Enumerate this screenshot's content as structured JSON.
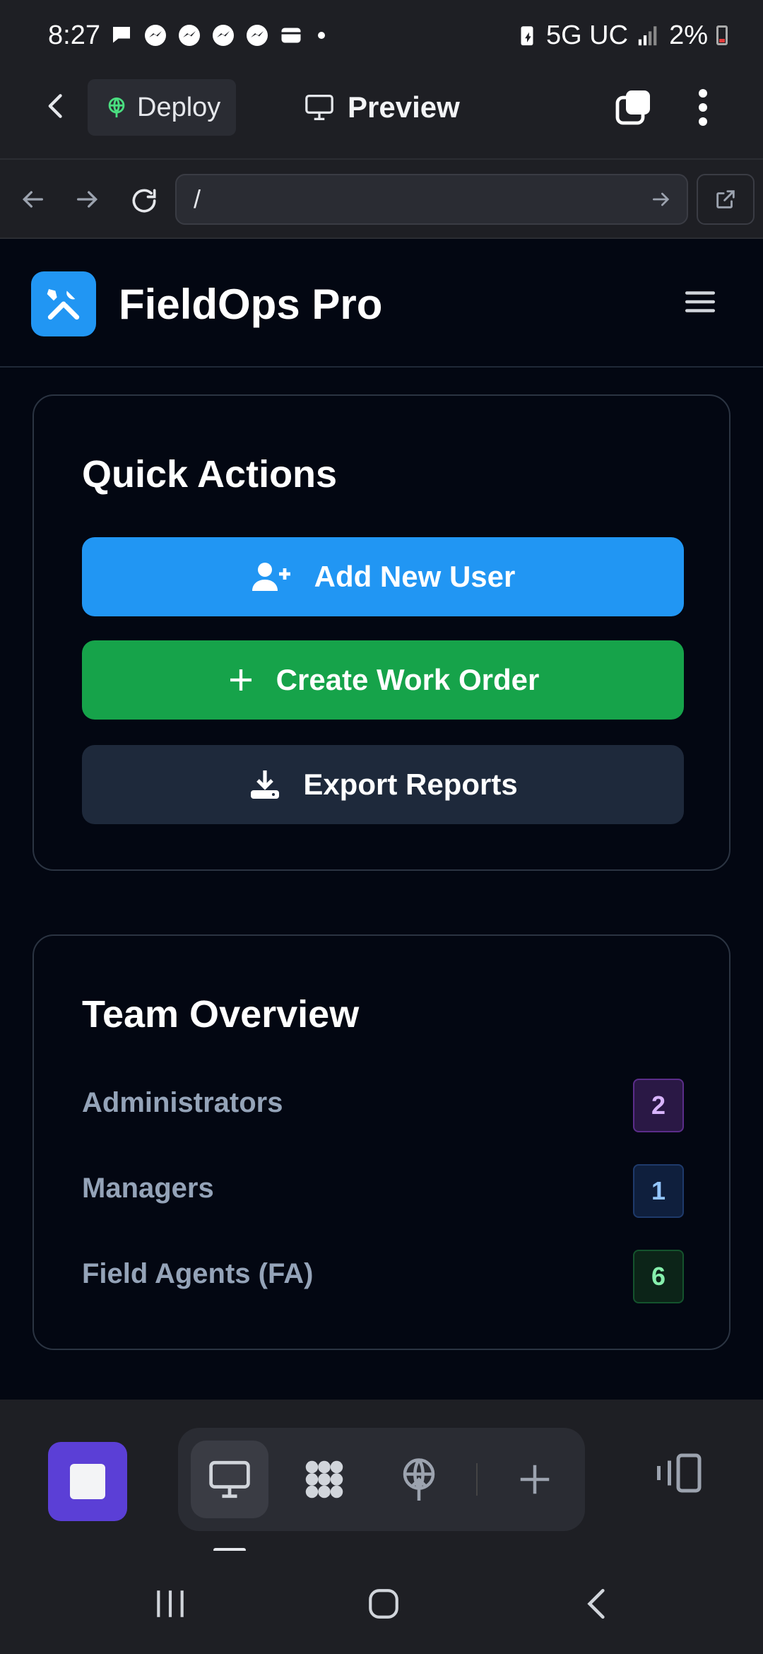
{
  "status_bar": {
    "time": "8:27",
    "network": "5G UC",
    "battery": "2%"
  },
  "app_header": {
    "deploy_label": "Deploy",
    "preview_label": "Preview"
  },
  "url_bar": {
    "value": "/"
  },
  "site": {
    "brand": "FieldOps Pro"
  },
  "quick_actions": {
    "title": "Quick Actions",
    "buttons": [
      {
        "label": "Add New User",
        "icon": "user-plus-icon",
        "color": "#2196f3"
      },
      {
        "label": "Create Work Order",
        "icon": "plus-icon",
        "color": "#16a34a"
      },
      {
        "label": "Export Reports",
        "icon": "download-icon",
        "color": "#1e293b"
      }
    ]
  },
  "team_overview": {
    "title": "Team Overview",
    "rows": [
      {
        "label": "Administrators",
        "count": "2",
        "color": "#d8b4fe",
        "bg": "#2a1845",
        "border": "#5b2d8a"
      },
      {
        "label": "Managers",
        "count": "1",
        "color": "#93c5fd",
        "bg": "#0f1f3d",
        "border": "#1e3a6b"
      },
      {
        "label": "Field Agents (FA)",
        "count": "6",
        "color": "#86efac",
        "bg": "#0c2418",
        "border": "#14532d"
      }
    ]
  }
}
